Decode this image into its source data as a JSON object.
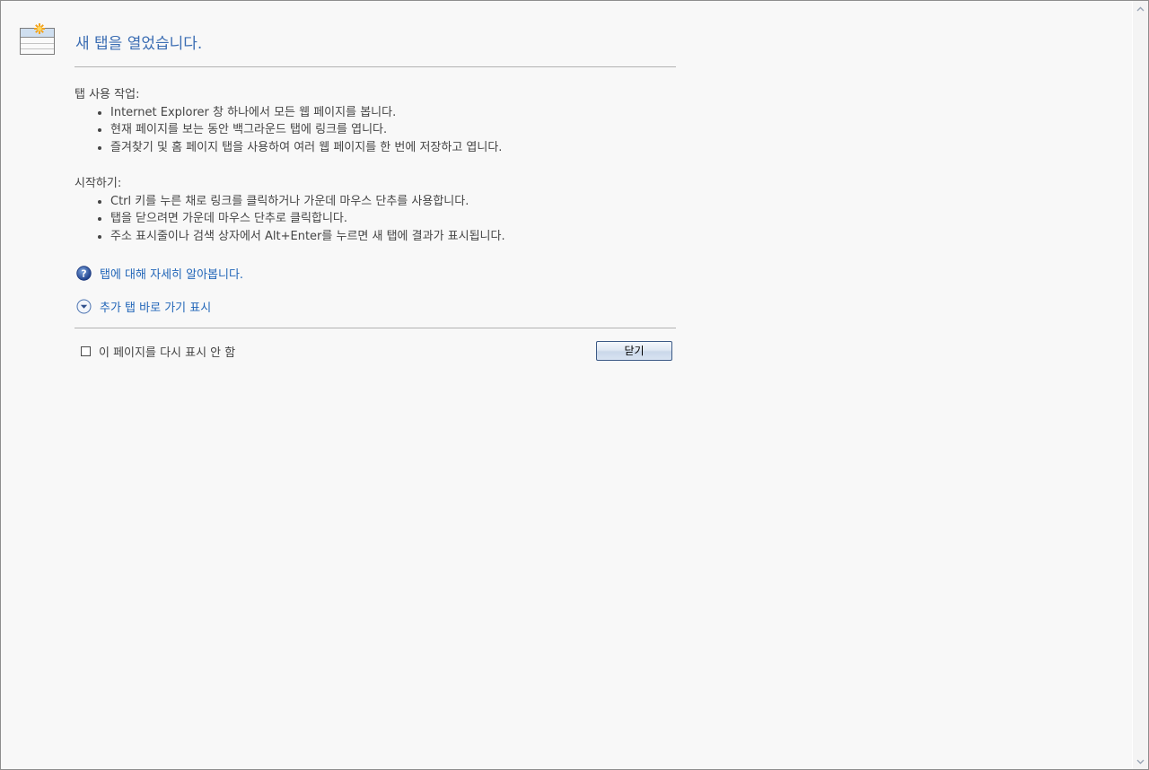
{
  "page": {
    "title": "새 탭을 열었습니다."
  },
  "sections": [
    {
      "heading": "탭 사용 작업:",
      "items": [
        "Internet Explorer 창 하나에서 모든 웹 페이지를 봅니다.",
        "현재 페이지를 보는 동안 백그라운드 탭에 링크를 엽니다.",
        "즐겨찾기 및 홈 페이지 탭을 사용하여 여러 웹 페이지를 한 번에 저장하고 엽니다."
      ]
    },
    {
      "heading": "시작하기:",
      "items": [
        "Ctrl 키를 누른 채로 링크를 클릭하거나 가운데 마우스 단추를 사용합니다.",
        "탭을 닫으려면 가운데 마우스 단추로 클릭합니다.",
        "주소 표시줄이나 검색 상자에서 Alt+Enter를 누르면 새 탭에 결과가 표시됩니다."
      ]
    }
  ],
  "links": {
    "help": "탭에 대해 자세히 알아봅니다.",
    "more_tabs": "추가 탭 바로 가기 표시"
  },
  "footer": {
    "checkbox_label": "이 페이지를 다시 표시 안 함",
    "checkbox_checked": false,
    "close_label": "닫기"
  },
  "icons": {
    "page": "new-tab-icon",
    "help": "help-icon",
    "expand": "expand-down-icon"
  },
  "colors": {
    "title": "#3b6db3",
    "link": "#2266b8",
    "body_text": "#444444",
    "background": "#f8f8f8"
  }
}
